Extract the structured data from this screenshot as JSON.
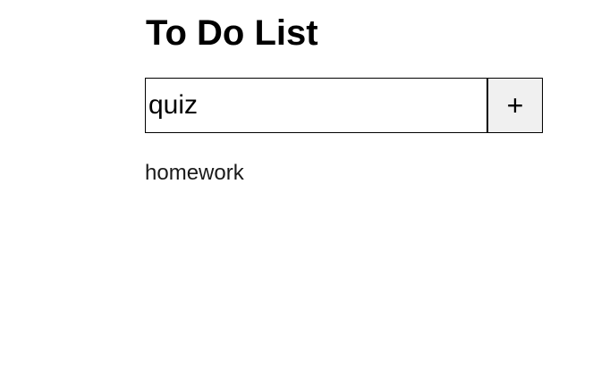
{
  "app": {
    "title": "To Do List"
  },
  "entry": {
    "value": "quiz",
    "add_label": "+"
  },
  "todos": [
    {
      "label": "homework"
    }
  ]
}
